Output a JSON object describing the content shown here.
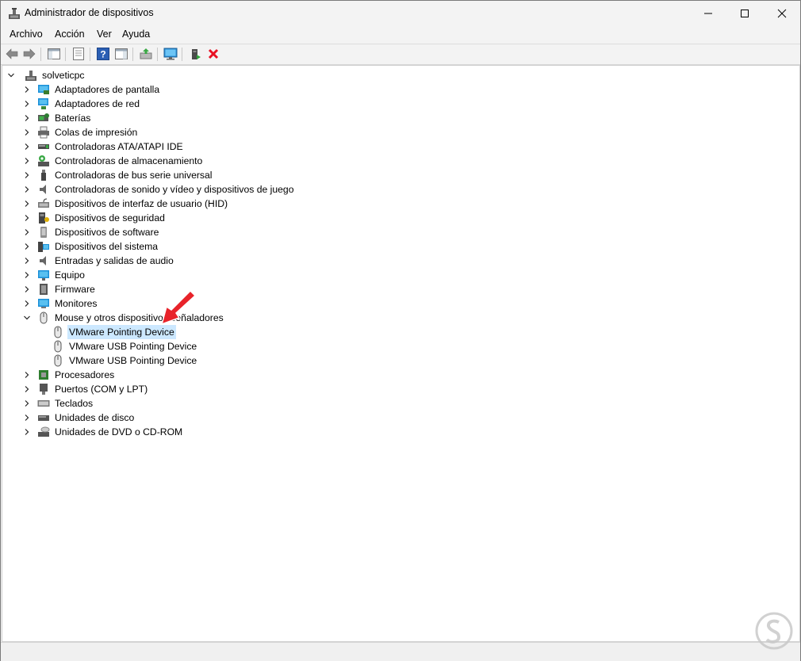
{
  "window": {
    "title": "Administrador de dispositivos"
  },
  "menu": {
    "items": [
      "Archivo",
      "Acción",
      "Ver",
      "Ayuda"
    ]
  },
  "toolbar": {
    "buttons": [
      "back-icon",
      "forward-icon",
      "show-hide-console-tree-icon",
      "properties-icon",
      "help-icon",
      "action-pane-icon",
      "update-driver-icon",
      "scan-hardware-icon",
      "enable-device-icon",
      "uninstall-device-icon"
    ],
    "uninstall_color": "#e81123"
  },
  "tree": {
    "root": "solveticpc",
    "categories": [
      "Adaptadores de pantalla",
      "Adaptadores de red",
      "Baterías",
      "Colas de impresión",
      "Controladoras ATA/ATAPI IDE",
      "Controladoras de almacenamiento",
      "Controladoras de bus serie universal",
      "Controladoras de sonido y vídeo y dispositivos de juego",
      "Dispositivos de interfaz de usuario (HID)",
      "Dispositivos de seguridad",
      "Dispositivos de software",
      "Dispositivos del sistema",
      "Entradas y salidas de audio",
      "Equipo",
      "Firmware",
      "Monitores",
      "Mouse y otros dispositivos señaladores",
      "Procesadores",
      "Puertos (COM y LPT)",
      "Teclados",
      "Unidades de disco",
      "Unidades de DVD o CD-ROM"
    ],
    "expanded_category": "Mouse y otros dispositivos señaladores",
    "children": [
      "VMware Pointing Device",
      "VMware USB Pointing Device",
      "VMware USB Pointing Device"
    ],
    "selected": "VMware Pointing Device",
    "selection_color": "#cce8ff"
  },
  "annotation": {
    "arrow_color": "#e8232a"
  }
}
